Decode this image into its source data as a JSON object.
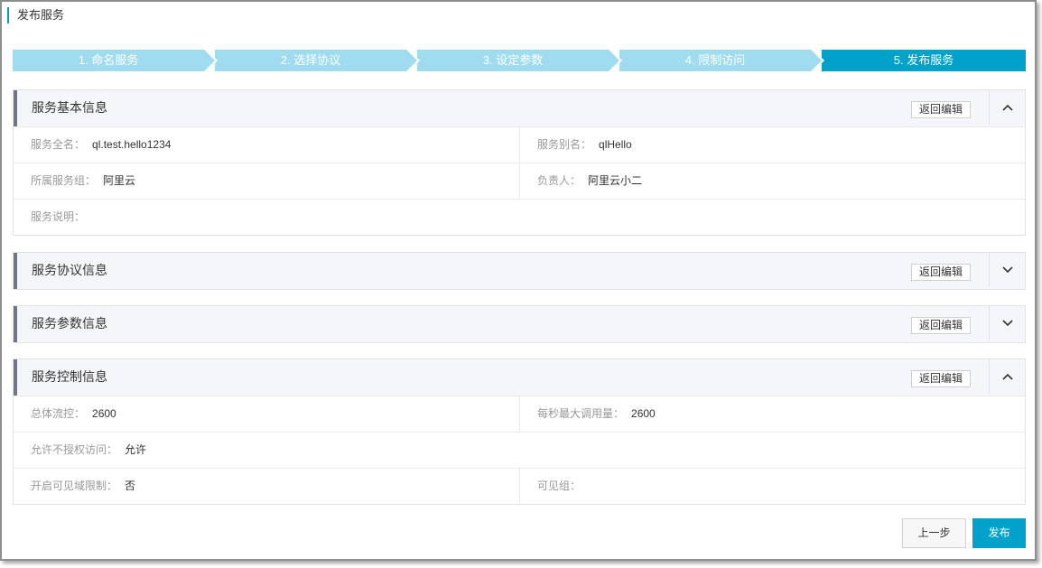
{
  "page": {
    "title": "发布服务"
  },
  "steps": [
    {
      "label": "1. 命名服务"
    },
    {
      "label": "2. 选择协议"
    },
    {
      "label": "3. 设定参数"
    },
    {
      "label": "4. 限制访问"
    },
    {
      "label": "5. 发布服务"
    }
  ],
  "edit_label": "返回编辑",
  "panels": {
    "basic": {
      "title": "服务基本信息",
      "expanded": true,
      "fields": {
        "full_name_label": "服务全名：",
        "full_name": "ql.test.hello1234",
        "alias_label": "服务别名：",
        "alias": "qlHello",
        "group_label": "所属服务组：",
        "group": "阿里云",
        "owner_label": "负责人：",
        "owner": "阿里云小二",
        "desc_label": "服务说明："
      }
    },
    "protocol": {
      "title": "服务协议信息",
      "expanded": false
    },
    "params": {
      "title": "服务参数信息",
      "expanded": false
    },
    "control": {
      "title": "服务控制信息",
      "expanded": true,
      "fields": {
        "total_flow_label": "总体流控：",
        "total_flow": "2600",
        "max_calls_label": "每秒最大调用量：",
        "max_calls": "2600",
        "unauth_label": "允许不授权访问：",
        "unauth": "允许",
        "visible_label": "开启可见域限制：",
        "visible": "否",
        "visible_group_label": "可见组："
      }
    }
  },
  "footer": {
    "prev_label": "上一步",
    "publish_label": "发布"
  },
  "colors": {
    "accent": "#00a2ca",
    "step_inactive": "#9fdcf0"
  },
  "icons": {
    "collapse": "chevron-up-icon",
    "expand": "chevron-down-icon"
  }
}
